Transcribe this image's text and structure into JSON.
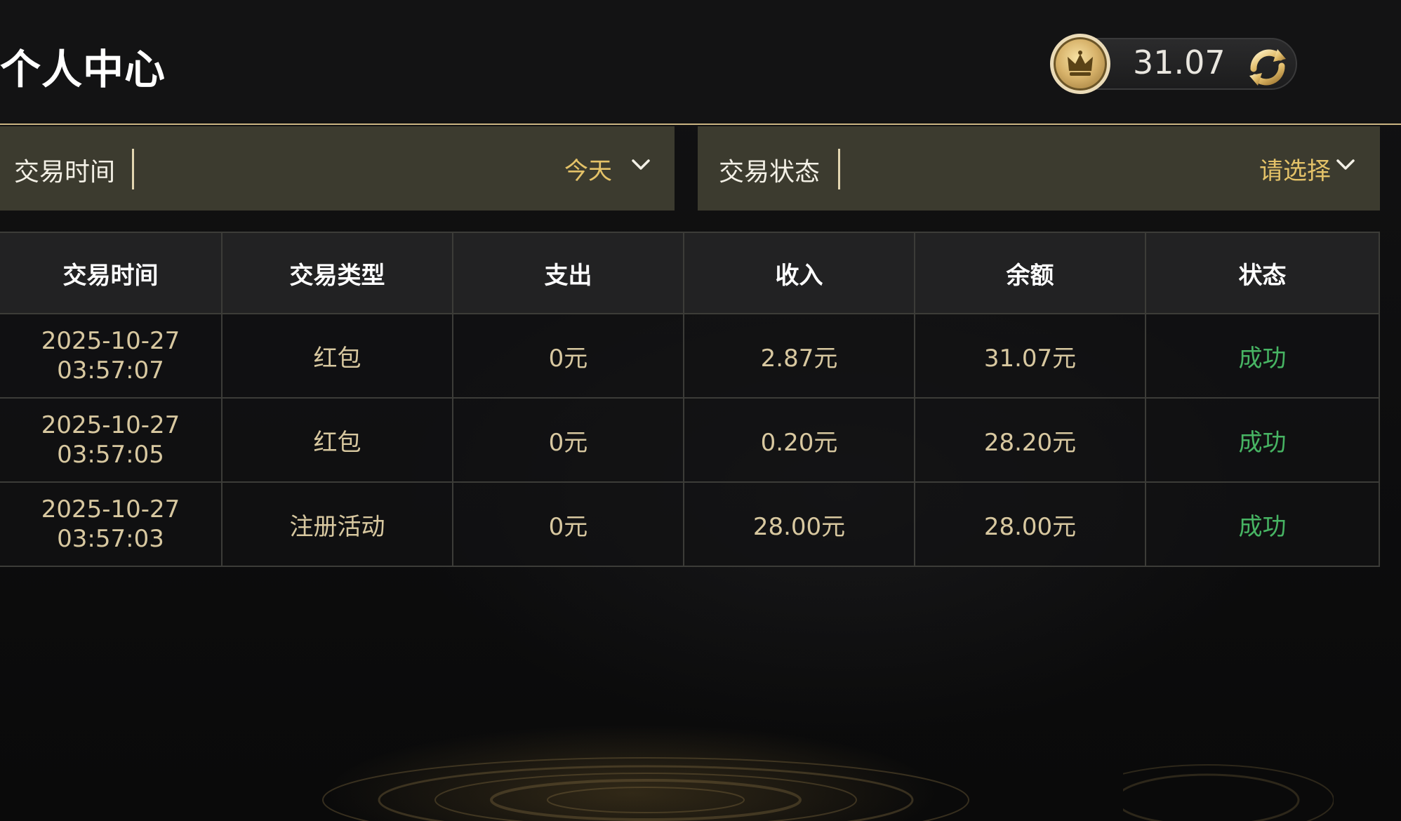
{
  "header": {
    "title": "个人中心",
    "balance": "31.07",
    "coin_icon": "crown-coin-icon",
    "refresh_icon": "refresh-icon"
  },
  "filters": {
    "time": {
      "label": "交易时间",
      "value": "今天",
      "icon": "chevron-down-icon"
    },
    "status": {
      "label": "交易状态",
      "value": "请选择",
      "icon": "chevron-down-icon"
    }
  },
  "table": {
    "columns": [
      "交易时间",
      "交易类型",
      "支出",
      "收入",
      "余额",
      "状态"
    ],
    "rows": [
      {
        "date": "2025-10-27",
        "time": "03:57:07",
        "type": "红包",
        "expense": "0元",
        "income": "2.87元",
        "balance": "31.07元",
        "status": "成功"
      },
      {
        "date": "2025-10-27",
        "time": "03:57:05",
        "type": "红包",
        "expense": "0元",
        "income": "0.20元",
        "balance": "28.20元",
        "status": "成功"
      },
      {
        "date": "2025-10-27",
        "time": "03:57:03",
        "type": "注册活动",
        "expense": "0元",
        "income": "28.00元",
        "balance": "28.00元",
        "status": "成功"
      }
    ]
  },
  "colors": {
    "accent_gold": "#e4c268",
    "success_green": "#47b463",
    "filter_bg": "#3c3b2f",
    "header_line": "#cbb583"
  }
}
